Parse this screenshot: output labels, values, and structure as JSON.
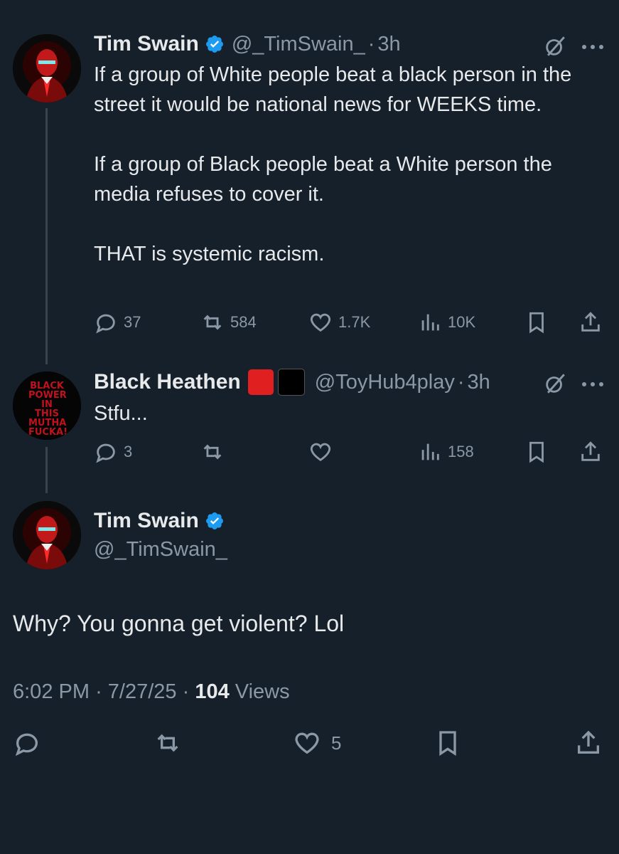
{
  "tweets": [
    {
      "name": "Tim Swain",
      "handle": "@_TimSwain_",
      "time": "3h",
      "text": "If a group of White people beat a black person in the street it would be national news for WEEKS time.\n\nIf a group of Black people beat a White person the media refuses to cover it.\n\nTHAT is systemic racism.",
      "replies": "37",
      "retweets": "584",
      "likes": "1.7K",
      "views": "10K"
    },
    {
      "name": "Black Heathen",
      "handle": "@ToyHub4play",
      "time": "3h",
      "text": "Stfu...",
      "replies": "3",
      "views": "158",
      "avatar_text": "BLACK POWER IN THIS MUTHA FUCKA!"
    }
  ],
  "main_tweet": {
    "name": "Tim Swain",
    "handle": "@_TimSwain_",
    "text": "Why? You gonna get violent? Lol",
    "time": "6:02 PM",
    "date": "7/27/25",
    "views_count": "104",
    "views_label": "Views",
    "likes": "5"
  },
  "colors": {
    "background": "#15202b",
    "text": "#e7e9ea",
    "muted": "#8b98a5",
    "verified": "#1d9bf0"
  },
  "icons": [
    "reply-icon",
    "retweet-icon",
    "like-icon",
    "views-icon",
    "bookmark-icon",
    "share-icon",
    "grok-icon",
    "more-icon",
    "verified-icon"
  ]
}
